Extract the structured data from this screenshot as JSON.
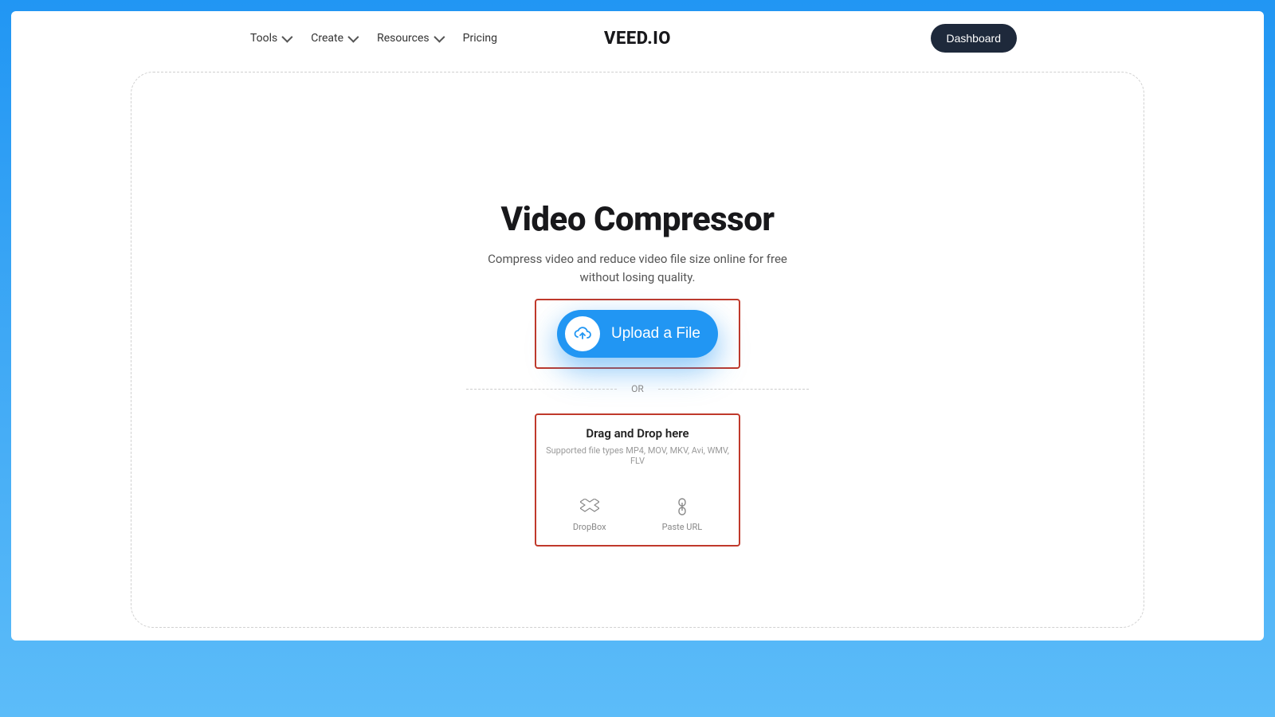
{
  "nav": {
    "items": [
      "Tools",
      "Create",
      "Resources",
      "Pricing"
    ]
  },
  "logo": "VEED.IO",
  "dashboard_label": "Dashboard",
  "main": {
    "title": "Video Compressor",
    "subtitle": "Compress video and reduce video file size online for free without losing quality.",
    "upload_label": "Upload a File",
    "or_label": "OR",
    "drop_title": "Drag and Drop here",
    "drop_sub": "Supported file types MP4, MOV, MKV, Avi, WMV, FLV",
    "dropbox_label": "DropBox",
    "pasteurl_label": "Paste URL"
  }
}
